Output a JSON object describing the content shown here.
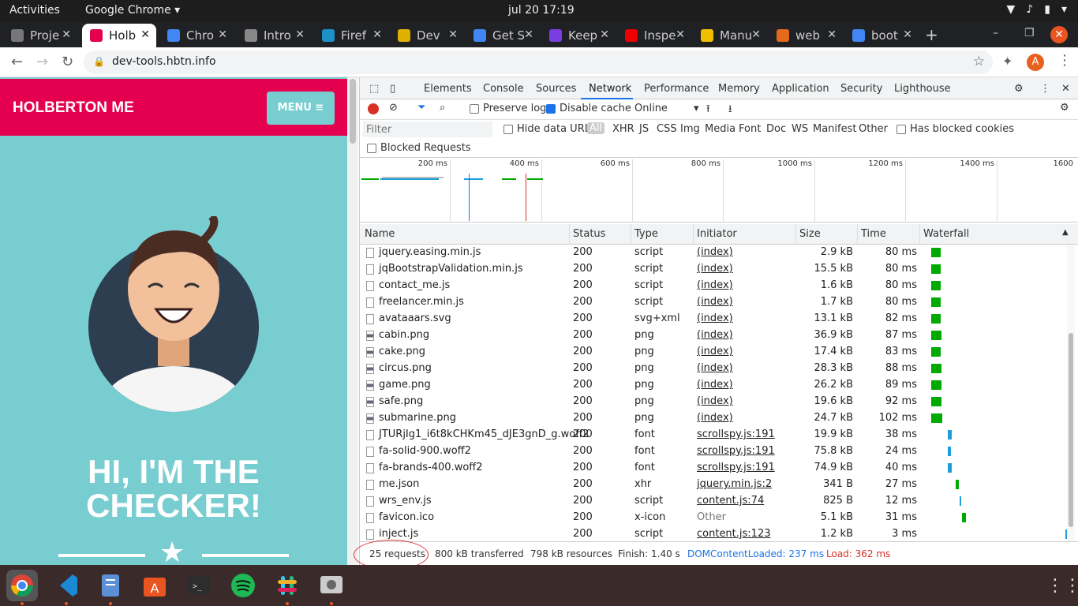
{
  "topbar": {
    "activities": "Activities",
    "app": "Google Chrome",
    "clock": "jul 20  17:19"
  },
  "tabs": [
    {
      "title": "Proje",
      "color": "#777"
    },
    {
      "title": "Holb",
      "color": "#e4004e"
    },
    {
      "title": "Chro",
      "color": "#4285f4"
    },
    {
      "title": "Intro",
      "color": "#888"
    },
    {
      "title": "Firef",
      "color": "#1e90c8"
    },
    {
      "title": "Dev",
      "color": "#e0b000"
    },
    {
      "title": "Get S",
      "color": "#4285f4"
    },
    {
      "title": "Keep",
      "color": "#7a3ee0"
    },
    {
      "title": "Inspe",
      "color": "#e00"
    },
    {
      "title": "Manu",
      "color": "#f0c000"
    },
    {
      "title": "web",
      "color": "#e56a1c"
    },
    {
      "title": "boot",
      "color": "#4285f4"
    }
  ],
  "address": {
    "url": "dev-tools.hbtn.info",
    "avatar": "A"
  },
  "page": {
    "brand": "HOLBERTON ME",
    "menu": "MENU ≡",
    "hero": "HI, I'M THE CHECKER!"
  },
  "devtools": {
    "tabs": [
      "Elements",
      "Console",
      "Sources",
      "Network",
      "Performance",
      "Memory",
      "Application",
      "Security",
      "Lighthouse"
    ],
    "active_tab": "Network",
    "toolbar": {
      "preserve_log": "Preserve log",
      "disable_cache": "Disable cache",
      "throttle": "Online"
    },
    "filter": {
      "placeholder": "Filter",
      "hide_data_urls": "Hide data URLs",
      "types": [
        "All",
        "XHR",
        "JS",
        "CSS",
        "Img",
        "Media",
        "Font",
        "Doc",
        "WS",
        "Manifest",
        "Other"
      ],
      "has_blocked": "Has blocked cookies",
      "blocked_requests": "Blocked Requests"
    },
    "overview_ticks": [
      "200 ms",
      "400 ms",
      "600 ms",
      "800 ms",
      "1000 ms",
      "1200 ms",
      "1400 ms",
      "1600"
    ],
    "columns": [
      "Name",
      "Status",
      "Type",
      "Initiator",
      "Size",
      "Time",
      "Waterfall"
    ],
    "rows": [
      {
        "name": "jquery.easing.min.js",
        "status": "200",
        "type": "script",
        "initiator": "(index)",
        "size": "2.9 kB",
        "time": "80 ms",
        "wf": [
          12,
          12
        ],
        "wfc": "#0a0"
      },
      {
        "name": "jqBootstrapValidation.min.js",
        "status": "200",
        "type": "script",
        "initiator": "(index)",
        "size": "15.5 kB",
        "time": "80 ms",
        "wf": [
          12,
          12
        ],
        "wfc": "#0a0"
      },
      {
        "name": "contact_me.js",
        "status": "200",
        "type": "script",
        "initiator": "(index)",
        "size": "1.6 kB",
        "time": "80 ms",
        "wf": [
          12,
          12
        ],
        "wfc": "#0a0"
      },
      {
        "name": "freelancer.min.js",
        "status": "200",
        "type": "script",
        "initiator": "(index)",
        "size": "1.7 kB",
        "time": "80 ms",
        "wf": [
          12,
          12
        ],
        "wfc": "#0a0"
      },
      {
        "name": "avataaars.svg",
        "status": "200",
        "type": "svg+xml",
        "initiator": "(index)",
        "size": "13.1 kB",
        "time": "82 ms",
        "wf": [
          12,
          12
        ],
        "wfc": "#0a0"
      },
      {
        "name": "cabin.png",
        "status": "200",
        "type": "png",
        "initiator": "(index)",
        "size": "36.9 kB",
        "time": "87 ms",
        "wf": [
          12,
          13
        ],
        "wfc": "#0a0"
      },
      {
        "name": "cake.png",
        "status": "200",
        "type": "png",
        "initiator": "(index)",
        "size": "17.4 kB",
        "time": "83 ms",
        "wf": [
          12,
          12
        ],
        "wfc": "#0a0"
      },
      {
        "name": "circus.png",
        "status": "200",
        "type": "png",
        "initiator": "(index)",
        "size": "28.3 kB",
        "time": "88 ms",
        "wf": [
          12,
          13
        ],
        "wfc": "#0a0"
      },
      {
        "name": "game.png",
        "status": "200",
        "type": "png",
        "initiator": "(index)",
        "size": "26.2 kB",
        "time": "89 ms",
        "wf": [
          12,
          13
        ],
        "wfc": "#0a0"
      },
      {
        "name": "safe.png",
        "status": "200",
        "type": "png",
        "initiator": "(index)",
        "size": "19.6 kB",
        "time": "92 ms",
        "wf": [
          12,
          13
        ],
        "wfc": "#0a0"
      },
      {
        "name": "submarine.png",
        "status": "200",
        "type": "png",
        "initiator": "(index)",
        "size": "24.7 kB",
        "time": "102 ms",
        "wf": [
          12,
          14
        ],
        "wfc": "#0a0"
      },
      {
        "name": "JTURjIg1_i6t8kCHKm45_dJE3gnD_g.woff2",
        "status": "200",
        "type": "font",
        "initiator": "scrollspy.js:191",
        "size": "19.9 kB",
        "time": "38 ms",
        "wf": [
          33,
          5
        ],
        "wfc": "#1a9fd9"
      },
      {
        "name": "fa-solid-900.woff2",
        "status": "200",
        "type": "font",
        "initiator": "scrollspy.js:191",
        "size": "75.8 kB",
        "time": "24 ms",
        "wf": [
          33,
          4
        ],
        "wfc": "#1a9fd9"
      },
      {
        "name": "fa-brands-400.woff2",
        "status": "200",
        "type": "font",
        "initiator": "scrollspy.js:191",
        "size": "74.9 kB",
        "time": "40 ms",
        "wf": [
          33,
          5
        ],
        "wfc": "#1a9fd9"
      },
      {
        "name": "me.json",
        "status": "200",
        "type": "xhr",
        "initiator": "jquery.min.js:2",
        "size": "341 B",
        "time": "27 ms",
        "wf": [
          43,
          4
        ],
        "wfc": "#0a0"
      },
      {
        "name": "wrs_env.js",
        "status": "200",
        "type": "script",
        "initiator": "content.js:74",
        "size": "825 B",
        "time": "12 ms",
        "wf": [
          48,
          2
        ],
        "wfc": "#1a9fd9"
      },
      {
        "name": "favicon.ico",
        "status": "200",
        "type": "x-icon",
        "initiator": "Other",
        "size": "5.1 kB",
        "time": "31 ms",
        "wf": [
          51,
          5
        ],
        "wfc": "#0a0"
      },
      {
        "name": "inject.js",
        "status": "200",
        "type": "script",
        "initiator": "content.js:123",
        "size": "1.2 kB",
        "time": "3 ms",
        "wf": [
          182,
          2
        ],
        "wfc": "#1a9fd9"
      }
    ],
    "status": {
      "requests": "25 requests",
      "transferred": "800 kB transferred",
      "resources": "798 kB resources",
      "finish": "Finish: 1.40 s",
      "dcl": "DOMContentLoaded: 237 ms",
      "load": "Load: 362 ms",
      "dcl_color": "#1a73e8",
      "load_color": "#d93025"
    }
  }
}
